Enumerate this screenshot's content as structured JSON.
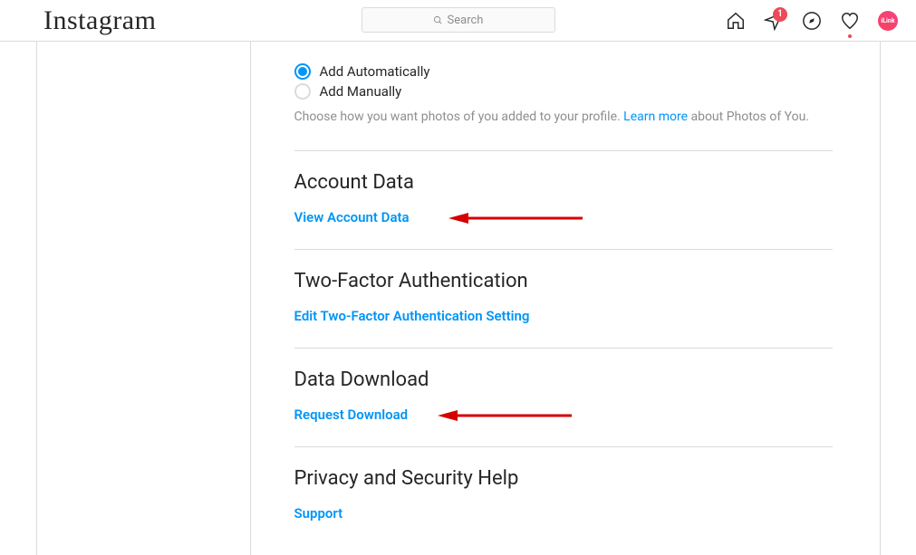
{
  "header": {
    "logo_text": "Instagram",
    "search_placeholder": "Search",
    "notification_badge": "1",
    "avatar_label": "iLink"
  },
  "photos_of_you": {
    "option_auto": "Add Automatically",
    "option_manual": "Add Manually",
    "help_pre": "Choose how you want photos of you added to your profile. ",
    "help_link": "Learn more",
    "help_post": " about Photos of You."
  },
  "sections": {
    "account_data": {
      "title": "Account Data",
      "action": "View Account Data"
    },
    "two_factor": {
      "title": "Two-Factor Authentication",
      "action": "Edit Two-Factor Authentication Setting"
    },
    "data_download": {
      "title": "Data Download",
      "action": "Request Download"
    },
    "privacy_help": {
      "title": "Privacy and Security Help",
      "action": "Support"
    }
  }
}
